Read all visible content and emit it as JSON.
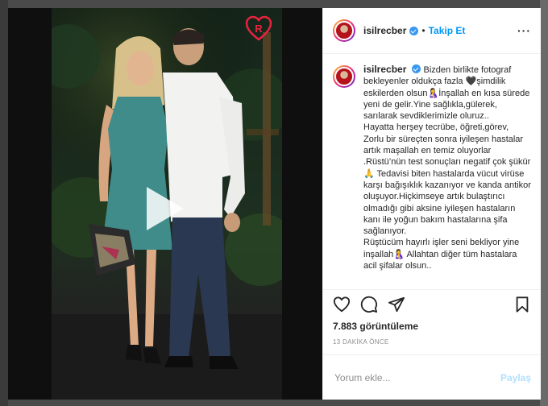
{
  "post": {
    "username": "isilrecber",
    "follow_label": "Takip Et",
    "caption_user": "isilrecber",
    "caption": "Bizden birlikte fotograf bekleyenler oldukça fazla 🖤şimdilik eskilerden olsun🤱İnşallah en kısa sürede yeni de gelir.Yine sağlıkla,gülerek, sarılarak sevdiklerimizle oluruz..\nHayatta herşey tecrübe, öğreti,görev, Zorlu bir süreçten sonra iyileşen hastalar artık maşallah en temiz oluyorlar .Rüstü’nün test sonuçları negatif çok şükür🙏 Tedavisi biten hastalarda vücut virüse karşı bağışıklık kazanıyor ve kanda antikor oluşuyor.Hiçkimseye artık bulaştırıcı olmadığı gibi aksine iyileşen hastaların kanı ile yoğun bakım hastalarına şifa sağlanıyor.\nRüştücüm hayırlı işler seni bekliyor yine inşallah🤱 Allahtan diğer tüm hastalara acil şifalar olsun..",
    "views": "7.883 görüntüleme",
    "time_ago": "13 DAKİKA ÖNCE",
    "comment_placeholder": "Yorum ekle...",
    "post_button": "Paylaş",
    "media_badge": "R"
  },
  "icons": {
    "like": "heart-icon",
    "comment": "comment-icon",
    "share": "paper-plane-icon",
    "save": "bookmark-icon",
    "more": "more-options-icon",
    "play": "play-icon"
  },
  "colors": {
    "link_blue": "#0095f6",
    "verified_blue": "#3897f0",
    "post_disabled": "#b2dffc",
    "badge_red": "#e8233f"
  }
}
